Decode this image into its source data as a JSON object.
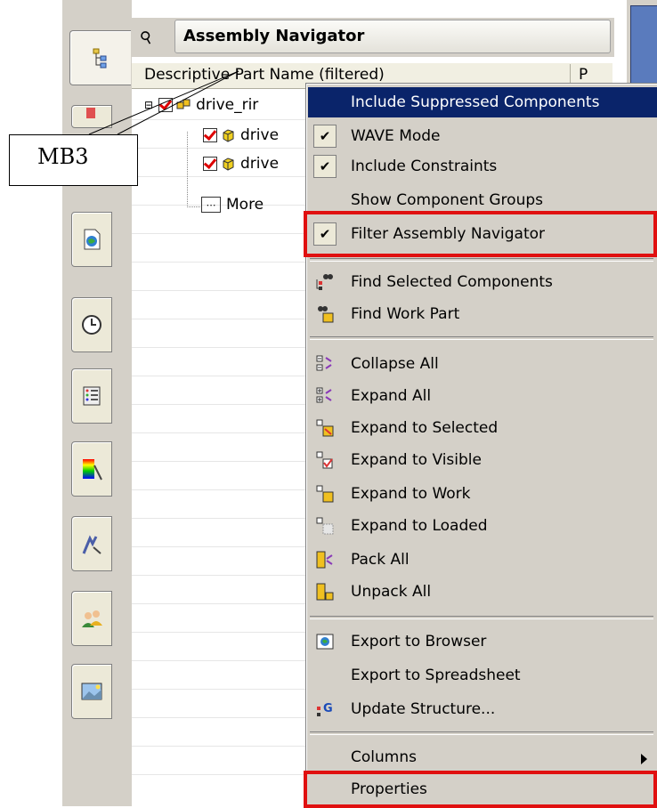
{
  "panel": {
    "title": "Assembly Navigator",
    "column_header": "Descriptive Part Name (filtered)",
    "column_p": "P"
  },
  "tree": {
    "rows": [
      {
        "label": "drive_rir"
      },
      {
        "label": "drive"
      },
      {
        "label": "drive"
      },
      {
        "label": "More"
      }
    ]
  },
  "left_tabs": [
    "assembly-navigator-icon",
    "part-navigator-icon",
    "web-browser-icon",
    "history-icon",
    "reuse-library-icon",
    "visualization-icon",
    "process-icon",
    "roles-icon",
    "system-scenes-icon"
  ],
  "context_menu": {
    "items": [
      {
        "label": "Include Suppressed Components",
        "highlighted": true
      },
      {
        "label": "WAVE Mode",
        "checked": true
      },
      {
        "label": "Include Constraints",
        "checked": true
      },
      {
        "label": "Show Component Groups"
      },
      {
        "label": "Filter Assembly Navigator",
        "checked": true
      },
      {
        "label": "Find Selected Components"
      },
      {
        "label": "Find Work Part"
      },
      {
        "label": "Collapse All"
      },
      {
        "label": "Expand All"
      },
      {
        "label": "Expand to Selected"
      },
      {
        "label": "Expand to Visible"
      },
      {
        "label": "Expand to Work"
      },
      {
        "label": "Expand to Loaded"
      },
      {
        "label": "Pack All"
      },
      {
        "label": "Unpack All"
      },
      {
        "label": "Export to Browser"
      },
      {
        "label": "Export to Spreadsheet"
      },
      {
        "label": "Update Structure..."
      },
      {
        "label": "Columns"
      },
      {
        "label": "Properties"
      }
    ]
  },
  "callout": {
    "label": "MB3"
  },
  "colors": {
    "highlight": "#0a246a",
    "annotation_red": "#e01010",
    "menu_bg": "#d4d0c8"
  }
}
